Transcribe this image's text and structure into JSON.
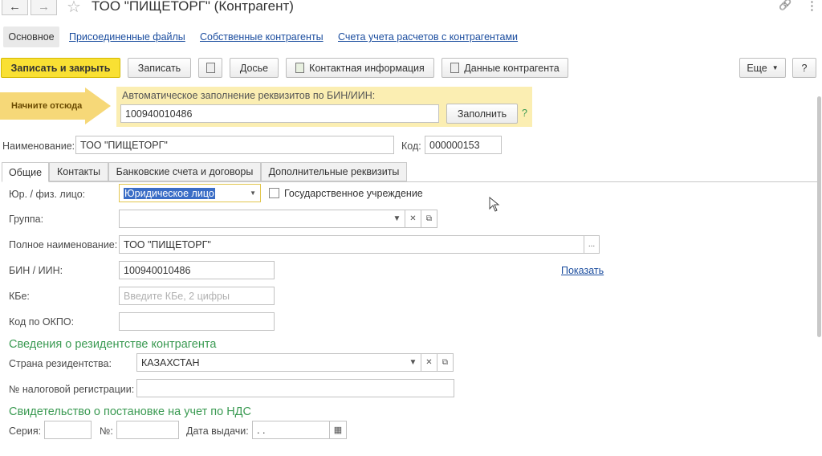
{
  "window": {
    "title": "ТОО \"ПИЩЕТОРГ\" (Контрагент)",
    "back_icon": "←",
    "forward_icon": "→",
    "star_icon": "☆",
    "link_icon": "🔗",
    "menu_icon": "⋮",
    "close_icon": "×"
  },
  "top_tabs": {
    "active": "Основное",
    "links": [
      "Присоединенные файлы",
      "Собственные контрагенты",
      "Счета учета расчетов с контрагентами"
    ]
  },
  "toolbar": {
    "save_close": "Записать и закрыть",
    "save": "Записать",
    "dossier": "Досье",
    "contact_info": "Контактная информация",
    "counterparty_data": "Данные контрагента",
    "more": "Еще",
    "help": "?"
  },
  "autofill": {
    "hint": "Начните отсюда",
    "label": "Автоматическое заполнение реквизитов по БИН/ИИН:",
    "value": "100940010486",
    "fill_button": "Заполнить",
    "help": "?"
  },
  "header": {
    "name_label": "Наименование:",
    "name_value": "ТОО \"ПИЩЕТОРГ\"",
    "code_label": "Код:",
    "code_value": "000000153"
  },
  "form_tabs": [
    "Общие",
    "Контакты",
    "Банковские счета и договоры",
    "Дополнительные реквизиты"
  ],
  "general": {
    "entity_label": "Юр. / физ. лицо:",
    "entity_value": "Юридическое лицо",
    "state_inst_label": "Государственное учреждение",
    "group_label": "Группа:",
    "group_value": "",
    "fullname_label": "Полное наименование:",
    "fullname_value": "ТОО \"ПИЩЕТОРГ\"",
    "bin_label": "БИН / ИИН:",
    "bin_value": "100940010486",
    "show_link": "Показать",
    "kbe_label": "КБе:",
    "kbe_placeholder": "Введите КБе, 2 цифры",
    "okpo_label": "Код по ОКПО:",
    "okpo_value": ""
  },
  "residency": {
    "heading": "Сведения о резидентстве контрагента",
    "country_label": "Страна резидентства:",
    "country_value": "КАЗАХСТАН",
    "taxreg_label": "№ налоговой регистрации:",
    "taxreg_value": ""
  },
  "vat": {
    "heading": "Свидетельство о постановке на учет по НДС",
    "series_label": "Серия:",
    "number_label": "№:",
    "date_label": "Дата выдачи:",
    "date_value": " .  ."
  },
  "colors": {
    "primary_button": "#f9e033",
    "autofill_bg": "#fbeeb2",
    "section_heading": "#3a9a52",
    "link": "#1a4c9e"
  }
}
